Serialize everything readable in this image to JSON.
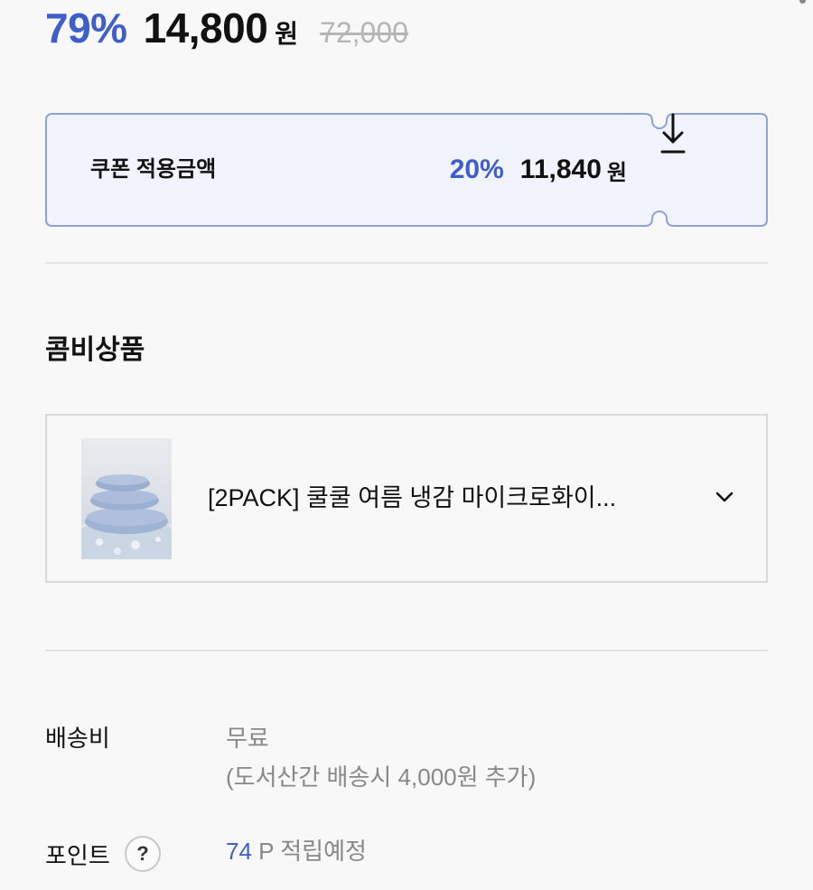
{
  "price": {
    "discount_rate": "79%",
    "sale_price": "14,800",
    "currency": "원",
    "original_price": "72,000",
    "accent_color": "#3e5fc9"
  },
  "coupon": {
    "label": "쿠폰 적용금액",
    "rate": "20%",
    "amount": "11,840",
    "currency": "원",
    "download_icon": "download-arrow-icon"
  },
  "combo": {
    "title": "콤비상품",
    "product_name": "[2PACK] 쿨쿨 여름 냉감 마이크로화이...",
    "thumbnail_icon": "pillow-stack-image",
    "expand_icon": "chevron-down-icon"
  },
  "shipping": {
    "label": "배송비",
    "value": "무료",
    "note": "(도서산간 배송시 4,000원 추가)"
  },
  "points": {
    "label": "포인트",
    "help_symbol": "?",
    "amount": "74",
    "suffix": " P 적립예정"
  }
}
